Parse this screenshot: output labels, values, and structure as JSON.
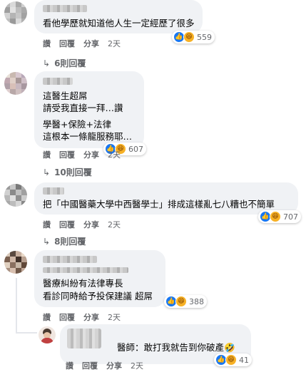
{
  "comments": [
    {
      "text_lines": [
        "看他學歷就知道他人生一定經歷了很多"
      ],
      "reaction_count": "559",
      "actions": {
        "like": "讚",
        "reply": "回覆",
        "share": "分享",
        "time": "2天"
      },
      "replies_label": "6則回覆"
    },
    {
      "text_lines": [
        "這醫生超屌",
        "請受我直接一拜…讚",
        "學醫+保險+法律",
        "這根本一條龍服務耶…"
      ],
      "reaction_count": "607",
      "actions": {
        "like": "讚",
        "reply": "回覆",
        "share": "分享",
        "time": "2天"
      },
      "replies_label": "10則回覆"
    },
    {
      "text_lines": [
        "把「中國醫藥大學中西醫學士」排成這樣亂七八糟也不簡單"
      ],
      "reaction_count": "707",
      "actions": {
        "like": "讚",
        "reply": "回覆",
        "share": "分享",
        "time": "2天"
      },
      "replies_label": "8則回覆"
    },
    {
      "text_lines": [
        "醫療糾紛有法律專長",
        "看診同時給予投保建議 超屌"
      ],
      "reaction_count": "388",
      "actions": {
        "like": "讚",
        "reply": "回覆",
        "share": "分享",
        "time": "2天"
      }
    }
  ],
  "reply": {
    "text": "醫師：敢打我就告到你破產🤣",
    "reaction_count": "41",
    "actions": {
      "like": "讚",
      "reply": "回覆",
      "share": "分享",
      "time": "2天"
    }
  },
  "icons": {
    "like": "👍",
    "haha": "😆"
  }
}
